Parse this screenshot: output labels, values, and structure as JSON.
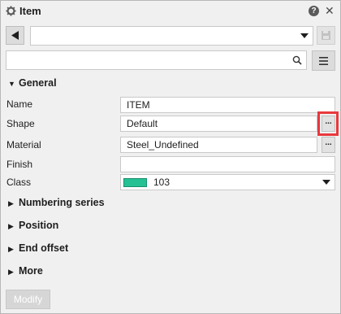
{
  "title": "Item",
  "icons": {
    "title": "gear-icon",
    "help": "help-icon",
    "close": "close-icon",
    "back": "back-arrow-icon",
    "dropdown": "chevron-down-icon",
    "save": "save-icon",
    "search": "search-icon",
    "menu": "menu-icon"
  },
  "toolbar": {
    "help_glyph": "?",
    "close_glyph": "✕",
    "preset_value": "",
    "search_value": "",
    "search_placeholder": ""
  },
  "sections": {
    "general": "General",
    "numbering": "Numbering series",
    "position": "Position",
    "end_offset": "End offset",
    "more": "More"
  },
  "properties": {
    "name": {
      "label": "Name",
      "value": "ITEM"
    },
    "shape": {
      "label": "Shape",
      "value": "Default",
      "button": "..."
    },
    "material": {
      "label": "Material",
      "value": "Steel_Undefined",
      "button": "..."
    },
    "finish": {
      "label": "Finish",
      "value": ""
    },
    "class": {
      "label": "Class",
      "value": "103",
      "swatch_color": "#25c195"
    }
  },
  "modify_label": "Modify",
  "colors": {
    "highlight": "#e8383d",
    "panel_bg": "#f0f0f0"
  }
}
